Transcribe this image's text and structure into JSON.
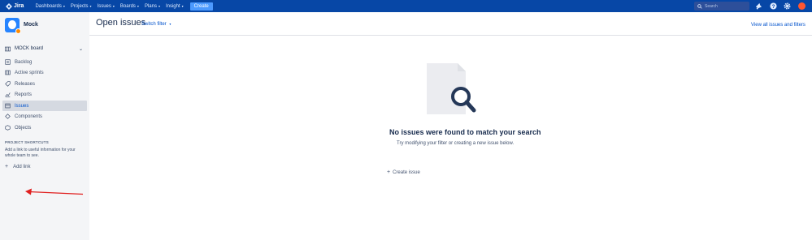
{
  "header": {
    "logo_text": "Jira",
    "nav": [
      {
        "label": "Dashboards",
        "caret": "▾"
      },
      {
        "label": "Projects",
        "caret": "▾"
      },
      {
        "label": "Issues",
        "caret": "▾"
      },
      {
        "label": "Boards",
        "caret": "▾"
      },
      {
        "label": "Plans",
        "caret": "▾"
      },
      {
        "label": "Insight",
        "caret": "▾"
      }
    ],
    "create_label": "Create",
    "search_placeholder": "Search",
    "icons": [
      "notifications-icon",
      "help-icon",
      "settings-icon",
      "user-avatar"
    ]
  },
  "sidebar": {
    "project_name": "Mock",
    "board_selector": "MOCK board",
    "items": [
      {
        "label": "Backlog",
        "icon": "backlog-icon"
      },
      {
        "label": "Active sprints",
        "icon": "active-sprints-icon"
      },
      {
        "label": "Releases",
        "icon": "releases-icon"
      },
      {
        "label": "Reports",
        "icon": "reports-icon"
      },
      {
        "label": "Issues",
        "icon": "issues-icon",
        "active": true
      },
      {
        "label": "Components",
        "icon": "components-icon"
      },
      {
        "label": "Objects",
        "icon": "objects-icon"
      }
    ],
    "shortcuts_heading": "PROJECT SHORTCUTS",
    "shortcuts_desc": "Add a link to useful information for your whole team to see.",
    "add_link_label": "Add link"
  },
  "main": {
    "title": "Open issues",
    "switch_filter": "Switch filter",
    "view_all": "View all issues and filters",
    "empty_title": "No issues were found to match your search",
    "empty_sub": "Try modifying your filter or creating a new issue below.",
    "create_issue": "Create issue"
  },
  "colors": {
    "nav_bg": "#0747a6",
    "sidebar_bg": "#f4f5f7",
    "link": "#0052cc",
    "annotation_arrow": "#e02020"
  }
}
